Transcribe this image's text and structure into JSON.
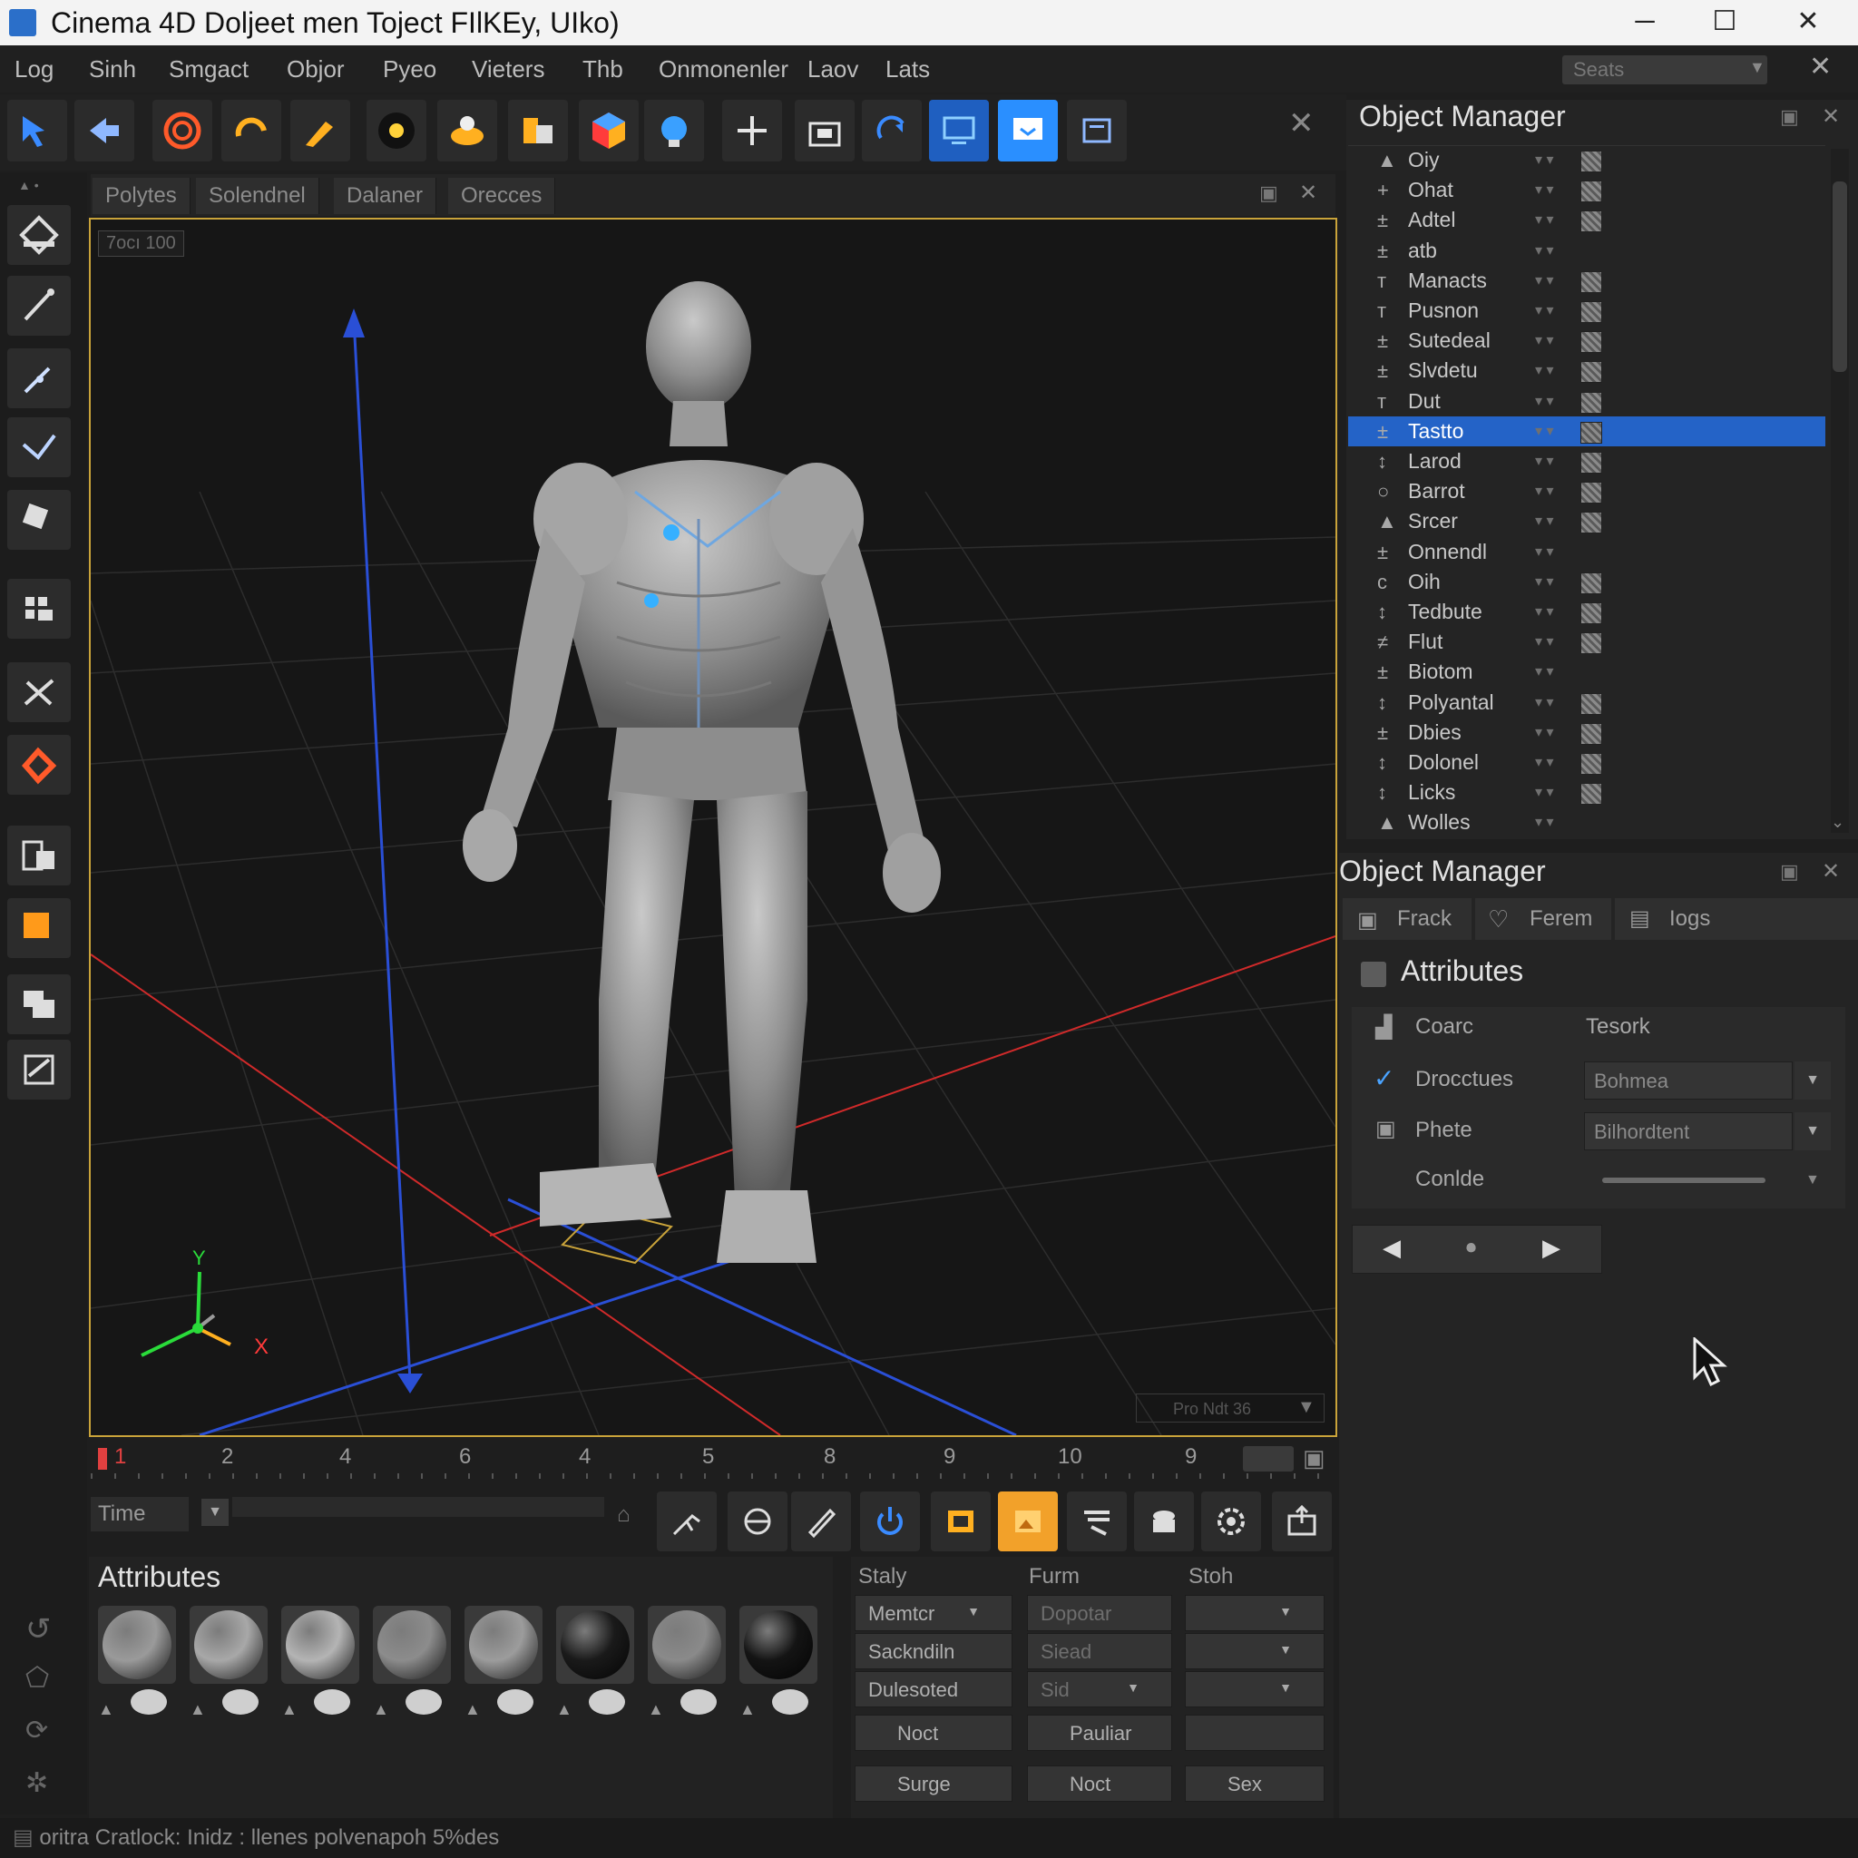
{
  "window": {
    "title": "Cinema 4D Doljeet men Toject FIlKEy, UIko)",
    "min": "─",
    "max": "☐",
    "close": "✕"
  },
  "menu": {
    "items": [
      "Log",
      "Sinh",
      "Smgact",
      "Objor",
      "Pyeo",
      "Vieters",
      "Thb",
      "Onmonenler",
      "Laov",
      "Lats"
    ],
    "search_placeholder": "Seats",
    "close": "✕"
  },
  "toolbar_close": "✕",
  "viewport": {
    "tabs": [
      "Polytes",
      "Solendnel",
      "Dalaner",
      "Orecces"
    ],
    "camera_label": "7ocı 100",
    "overlay_label": "Pro Ndt 36",
    "axis_x": "X",
    "axis_y": "Y"
  },
  "timeline": {
    "ticks": [
      "1",
      "2",
      "4",
      "6",
      "4",
      "5",
      "8",
      "9",
      "10",
      "9"
    ],
    "time_label": "Time"
  },
  "object_manager": {
    "title": "Object Manager",
    "selected_index": 9,
    "rows": [
      {
        "label": "Oiy",
        "mark": "▲"
      },
      {
        "label": "Ohat",
        "mark": "+"
      },
      {
        "label": "Adtel",
        "mark": "±"
      },
      {
        "label": "atb",
        "mark": "±"
      },
      {
        "label": "Manacts",
        "mark": "т"
      },
      {
        "label": "Pusnon",
        "mark": "т"
      },
      {
        "label": "Sutedeal",
        "mark": "±"
      },
      {
        "label": "Slvdetu",
        "mark": "±"
      },
      {
        "label": "Dut",
        "mark": "т"
      },
      {
        "label": "Tastto",
        "mark": "±"
      },
      {
        "label": "Larod",
        "mark": "↕"
      },
      {
        "label": "Barrot",
        "mark": "○"
      },
      {
        "label": "Srcer",
        "mark": "▲"
      },
      {
        "label": "Onnendl",
        "mark": "±"
      },
      {
        "label": "Oih",
        "mark": "c"
      },
      {
        "label": "Tedbute",
        "mark": "↕"
      },
      {
        "label": "Flut",
        "mark": "≠"
      },
      {
        "label": "Biotom",
        "mark": "±"
      },
      {
        "label": "Polyantal",
        "mark": "↕"
      },
      {
        "label": "Dbies",
        "mark": "±"
      },
      {
        "label": "Dolonel",
        "mark": "↕"
      },
      {
        "label": "Licks",
        "mark": "↕"
      },
      {
        "label": "Wolles",
        "mark": "▲"
      }
    ]
  },
  "attribute_manager": {
    "title": "Object Manager",
    "tabs": [
      "Frack",
      "Ferem",
      "Iogs"
    ],
    "section": "Attributes",
    "rows": [
      {
        "label": "Coarc",
        "value": "Tesork"
      },
      {
        "label": "Drocctues",
        "value": "Bohmea"
      },
      {
        "label": "Phete",
        "value": "Bilhordtent"
      },
      {
        "label": "Conlde",
        "value": ""
      }
    ]
  },
  "materials": {
    "title": "Attributes",
    "colors": [
      "#9a9a9a",
      "#a8a8a8",
      "#b4b4b4",
      "#8c8c8c",
      "#9c9c9c",
      "#1a1a1a",
      "#8a8a8a",
      "#141414"
    ]
  },
  "props": {
    "headers": [
      "Staly",
      "Furm",
      "Stoh"
    ],
    "rows": [
      [
        "Memtcr",
        "Dopotar",
        ""
      ],
      [
        "Sackndiln",
        "Siead",
        ""
      ],
      [
        "Dulesoted",
        "Sid",
        ""
      ]
    ],
    "bottom1": [
      "Noct",
      "Pauliar",
      ""
    ],
    "bottom2": [
      "Surge",
      "Noct",
      "Sex"
    ]
  },
  "status": {
    "text": "oritra Cratlock: Inidz :  llenes polvenapoh 5%des"
  }
}
